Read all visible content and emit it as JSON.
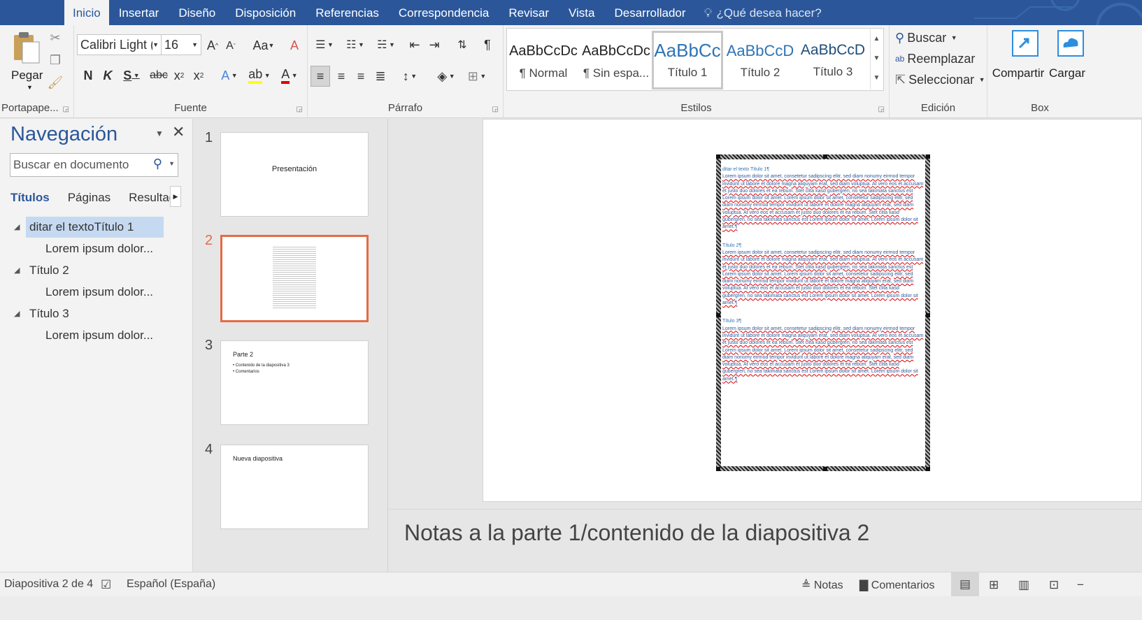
{
  "tabs": [
    "Inicio",
    "Insertar",
    "Diseño",
    "Disposición",
    "Referencias",
    "Correspondencia",
    "Revisar",
    "Vista",
    "Desarrollador"
  ],
  "active_tab": "Inicio",
  "tell_me": "¿Qué desea hacer?",
  "clipboard": {
    "paste_label": "Pegar",
    "group_label": "Portapape..."
  },
  "font": {
    "name": "Calibri Light (",
    "size": "16",
    "group_label": "Fuente",
    "bold": "N",
    "italic": "K",
    "underline": "S",
    "strike": "abc",
    "case": "Aa"
  },
  "paragraph": {
    "group_label": "Párrafo"
  },
  "styles": {
    "group_label": "Estilos",
    "items": [
      {
        "preview": "AaBbCcDc",
        "name": "¶ Normal"
      },
      {
        "preview": "AaBbCcDc",
        "name": "¶ Sin espa..."
      },
      {
        "preview": "AaBbCc",
        "name": "Título 1"
      },
      {
        "preview": "AaBbCcD",
        "name": "Título 2"
      },
      {
        "preview": "AaBbCcD",
        "name": "Título 3"
      }
    ]
  },
  "editing": {
    "group_label": "Edición",
    "find": "Buscar",
    "replace": "Reemplazar",
    "select": "Seleccionar"
  },
  "box": {
    "group_label": "Box",
    "share": "Compartir",
    "upload": "Cargar"
  },
  "navigation": {
    "title": "Navegación",
    "search_placeholder": "Buscar en documento",
    "tabs": [
      "Títulos",
      "Páginas",
      "Resultad"
    ],
    "tree": [
      {
        "label": "ditar el textoTítulo 1"
      },
      {
        "label": "Lorem ipsum dolor..."
      },
      {
        "label": "Título 2"
      },
      {
        "label": "Lorem ipsum dolor..."
      },
      {
        "label": "Título 3"
      },
      {
        "label": "Lorem ipsum dolor..."
      }
    ]
  },
  "thumbnails": [
    {
      "num": "1",
      "title": "Presentación"
    },
    {
      "num": "2",
      "title": ""
    },
    {
      "num": "3",
      "title": "Parte 2",
      "bullets": [
        "• Contenido de la diapositiva 3",
        "• Comentarios"
      ]
    },
    {
      "num": "4",
      "title": "Nueva diapositiva"
    }
  ],
  "doc": {
    "heading1": "ditar el texto Título 1¶",
    "heading2": "Título 2¶",
    "heading3": "Título 3¶",
    "para": "Lorem ipsum dolor sit amet, consetetur sadipscing elitr, sed diam nonumy eirmod tempor invidunt ut labore et dolore magna aliquyam erat, sed diam voluptua. At vero eos et accusam et justo duo dolores et ea rebum. Stet clita kasd gubergren, no sea takimata sanctus est Lorem ipsum dolor sit amet. Lorem ipsum dolor sit amet, consetetur sadipscing elitr, sed diam nonumy eirmod tempor invidunt ut labore et dolore magna aliquyam erat, sed diam voluptua. At vero eos et accusam et justo duo dolores et ea rebum. Stet clita kasd gubergren, no sea takimata sanctus est Lorem ipsum dolor sit amet. Lorem ipsum dolor sit amet.¶"
  },
  "notes": "Notas a la parte 1/contenido de la diapositiva 2",
  "status": {
    "slide": "Diapositiva 2 de 4",
    "language": "Español (España)",
    "notes": "Notas",
    "comments": "Comentarios"
  }
}
